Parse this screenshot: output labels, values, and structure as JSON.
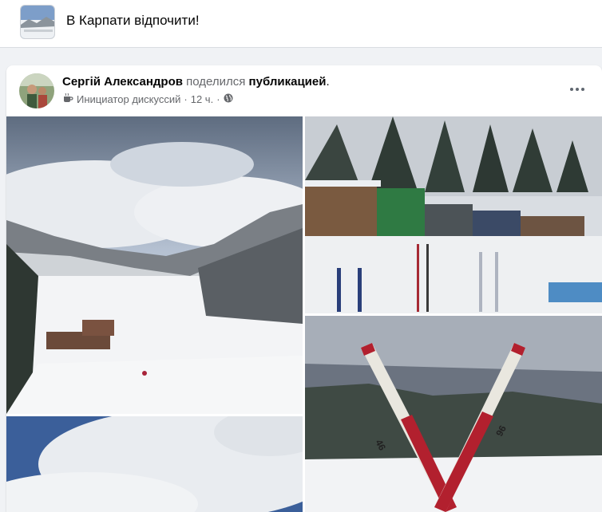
{
  "group": {
    "title": "В Карпати відпочити!"
  },
  "post": {
    "author": "Сергій Александров",
    "shared_text": "поделился",
    "shared_link": "публикацией",
    "period": ".",
    "badge": "Инициатор дискуссий",
    "separator": "·",
    "time": "12 ч.",
    "separator2": "·"
  },
  "photos": {
    "ski1_number": "46",
    "ski2_number": "96"
  },
  "icons": {
    "badge": "coffee-cup-icon",
    "audience": "globe-icon",
    "more": "more-options-icon"
  }
}
